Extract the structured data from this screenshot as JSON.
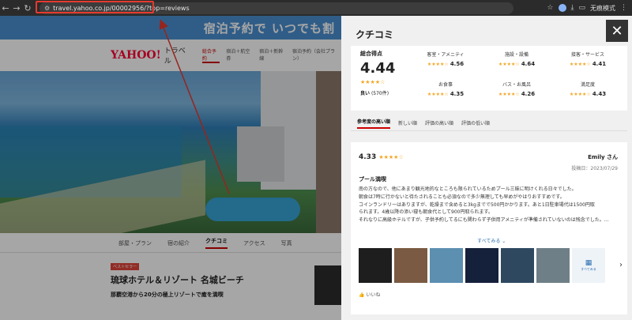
{
  "browser": {
    "url": "travel.yahoo.co.jp/00002956/?top=reviews",
    "incognito_label": "无痕模式"
  },
  "background_page": {
    "banner_text": "宿泊予約で いつでも割",
    "logo_yahoo": "YAHOO!",
    "logo_travel": "トラベル",
    "nav": [
      "総合予約",
      "宿泊＋航空券",
      "宿泊＋新幹線",
      "宿泊予約（会社プラン）"
    ],
    "tabs": [
      "部屋・プラン",
      "宿の紹介",
      "クチコミ",
      "アクセス",
      "写真"
    ],
    "active_tab": "クチコミ",
    "best_badge": "ベストセラー",
    "hotel_name": "琉球ホテル＆リゾート 名城ビーチ",
    "hotel_catch": "那覇空港から20分の極上リゾートで癒を満喫"
  },
  "panel": {
    "title": "クチコミ",
    "close_label": "✕",
    "overall": {
      "label": "総合得点",
      "score": "4.44",
      "stars": "★★★★☆",
      "count_prefix": "良い",
      "count": "(570件)"
    },
    "categories": [
      {
        "label": "客室・アメニティ",
        "stars": "★★★★☆",
        "value": "4.56"
      },
      {
        "label": "施設・設備",
        "stars": "★★★★☆",
        "value": "4.64"
      },
      {
        "label": "接客・サービス",
        "stars": "★★★★☆",
        "value": "4.41"
      },
      {
        "label": "お食事",
        "stars": "★★★★☆",
        "value": "4.35"
      },
      {
        "label": "バス・お風呂",
        "stars": "★★★★☆",
        "value": "4.26"
      },
      {
        "label": "満足度",
        "stars": "★★★★☆",
        "value": "4.43"
      }
    ],
    "sort_tabs": [
      "参考度の高い順",
      "新しい順",
      "評価の高い順",
      "評価の低い順"
    ],
    "active_sort": "参考度の高い順",
    "review": {
      "score": "4.33",
      "stars": "★★★★☆",
      "user": "Emily さん",
      "date": "投稿日：2023/07/29",
      "title": "プール満喫",
      "body_lines": [
        "南の方なので、他にあまり観光地的なところも限られているためプール三昧に明けくれる日々でした。",
        "朝食は7時に行かないと待たされることも必須なので多少無理しても早めがやはりおすすめです。",
        "コインランドリーはありますが、乾燥まで含めると3kgまでで500円かかります。あと1日駐車場代は1500円取",
        "られます。4歳以降の添い寝も朝食代として900円取られます。",
        "それなりに高級ホテルですが、子供予約してるにも関わらず子供用アメニティが準備されていないのは残念でした。…"
      ],
      "more_label": "すべてみる ⌄",
      "photo_all_label": "すべてみる",
      "like_label": "いいね"
    }
  },
  "colors": {
    "accent": "#cc0000",
    "star": "#f5a623",
    "annotation": "#e53a2f"
  }
}
